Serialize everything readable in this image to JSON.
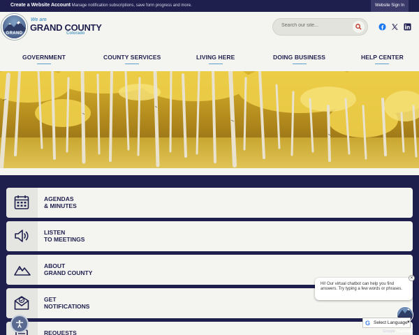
{
  "topbar": {
    "create_account": "Create a Website Account",
    "create_desc": "- Manage notification subscriptions, save form progress and more.",
    "sign_in": "Website Sign In"
  },
  "logo": {
    "we_are": "We are",
    "name": "GRAND COUNTY",
    "state": "Colorado",
    "badge_text": "GRAND"
  },
  "search": {
    "placeholder": "Search our site...",
    "button_icon": "search-icon"
  },
  "social": [
    "facebook-icon",
    "x-twitter-icon",
    "linkedin-icon"
  ],
  "nav": [
    "GOVERNMENT",
    "COUNTY SERVICES",
    "LIVING HERE",
    "DOING BUSINESS",
    "HELP CENTER"
  ],
  "quick_links": [
    {
      "label_line1": "AGENDAS",
      "label_line2": "& MINUTES",
      "icon": "calendar-icon"
    },
    {
      "label_line1": "LISTEN",
      "label_line2": "TO MEETINGS",
      "icon": "speaker-icon"
    },
    {
      "label_line1": "ABOUT",
      "label_line2": "GRAND COUNTY",
      "icon": "mountain-icon"
    },
    {
      "label_line1": "GET",
      "label_line2": "NOTIFICATIONS",
      "icon": "envelope-check-icon"
    },
    {
      "label_line1": "REQUESTS",
      "label_line2": "",
      "icon": "document-icon"
    }
  ],
  "chatbot": {
    "message": "Hi! Our virtual chatbot can help you find answers. Try typing a few words or phrases.",
    "close": "×",
    "avatar_text": "GRAND"
  },
  "translate": {
    "label": "Select Language",
    "arrow": "▼",
    "powered_by": "Google",
    "powered_suffix": "Translate"
  },
  "colors": {
    "navy": "#1f1f4e",
    "cream": "#f4f4f1",
    "accent_blue": "#5aa0c8"
  }
}
